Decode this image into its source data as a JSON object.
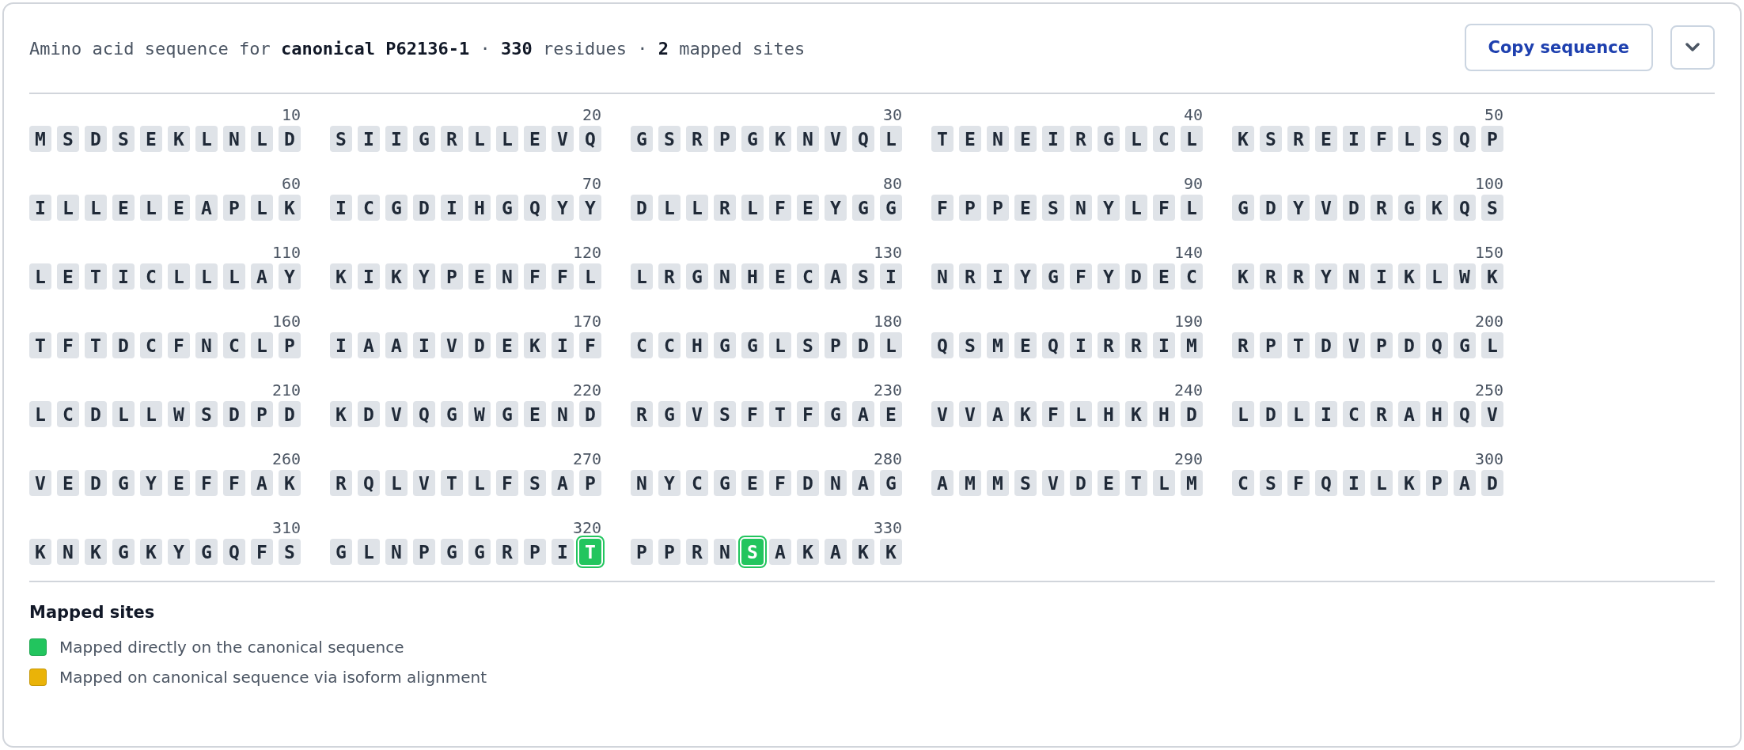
{
  "header": {
    "title": "Amino acid sequence for **canonical P62136-1** · **330** residues · **2** mapped sites",
    "copy_button": "Copy sequence",
    "menu_expanded": false
  },
  "sequence": {
    "blocks": [
      {
        "number": "10",
        "residues": [
          "M",
          "S",
          "D",
          "S",
          "E",
          "K",
          "L",
          "N",
          "L",
          "D"
        ]
      },
      {
        "number": "20",
        "residues": [
          "S",
          "I",
          "I",
          "G",
          "R",
          "L",
          "L",
          "E",
          "V",
          "Q"
        ]
      },
      {
        "number": "30",
        "residues": [
          "G",
          "S",
          "R",
          "P",
          "G",
          "K",
          "N",
          "V",
          "Q",
          "L"
        ]
      },
      {
        "number": "40",
        "residues": [
          "T",
          "E",
          "N",
          "E",
          "I",
          "R",
          "G",
          "L",
          "C",
          "L"
        ]
      },
      {
        "number": "50",
        "residues": [
          "K",
          "S",
          "R",
          "E",
          "I",
          "F",
          "L",
          "S",
          "Q",
          "P"
        ]
      },
      {
        "number": "60",
        "residues": [
          "I",
          "L",
          "L",
          "E",
          "L",
          "E",
          "A",
          "P",
          "L",
          "K"
        ]
      },
      {
        "number": "70",
        "residues": [
          "I",
          "C",
          "G",
          "D",
          "I",
          "H",
          "G",
          "Q",
          "Y",
          "Y"
        ]
      },
      {
        "number": "80",
        "residues": [
          "D",
          "L",
          "L",
          "R",
          "L",
          "F",
          "E",
          "Y",
          "G",
          "G"
        ]
      },
      {
        "number": "90",
        "residues": [
          "F",
          "P",
          "P",
          "E",
          "S",
          "N",
          "Y",
          "L",
          "F",
          "L"
        ]
      },
      {
        "number": "100",
        "residues": [
          "G",
          "D",
          "Y",
          "V",
          "D",
          "R",
          "G",
          "K",
          "Q",
          "S"
        ]
      },
      {
        "number": "110",
        "residues": [
          "L",
          "E",
          "T",
          "I",
          "C",
          "L",
          "L",
          "L",
          "A",
          "Y"
        ]
      },
      {
        "number": "120",
        "residues": [
          "K",
          "I",
          "K",
          "Y",
          "P",
          "E",
          "N",
          "F",
          "F",
          "L"
        ]
      },
      {
        "number": "130",
        "residues": [
          "L",
          "R",
          "G",
          "N",
          "H",
          "E",
          "C",
          "A",
          "S",
          "I"
        ]
      },
      {
        "number": "140",
        "residues": [
          "N",
          "R",
          "I",
          "Y",
          "G",
          "F",
          "Y",
          "D",
          "E",
          "C"
        ]
      },
      {
        "number": "150",
        "residues": [
          "K",
          "R",
          "R",
          "Y",
          "N",
          "I",
          "K",
          "L",
          "W",
          "K"
        ]
      },
      {
        "number": "160",
        "residues": [
          "T",
          "F",
          "T",
          "D",
          "C",
          "F",
          "N",
          "C",
          "L",
          "P"
        ]
      },
      {
        "number": "170",
        "residues": [
          "I",
          "A",
          "A",
          "I",
          "V",
          "D",
          "E",
          "K",
          "I",
          "F"
        ]
      },
      {
        "number": "180",
        "residues": [
          "C",
          "C",
          "H",
          "G",
          "G",
          "L",
          "S",
          "P",
          "D",
          "L"
        ]
      },
      {
        "number": "190",
        "residues": [
          "Q",
          "S",
          "M",
          "E",
          "Q",
          "I",
          "R",
          "R",
          "I",
          "M"
        ]
      },
      {
        "number": "200",
        "residues": [
          "R",
          "P",
          "T",
          "D",
          "V",
          "P",
          "D",
          "Q",
          "G",
          "L"
        ]
      },
      {
        "number": "210",
        "residues": [
          "L",
          "C",
          "D",
          "L",
          "L",
          "W",
          "S",
          "D",
          "P",
          "D"
        ]
      },
      {
        "number": "220",
        "residues": [
          "K",
          "D",
          "V",
          "Q",
          "G",
          "W",
          "G",
          "E",
          "N",
          "D"
        ]
      },
      {
        "number": "230",
        "residues": [
          "R",
          "G",
          "V",
          "S",
          "F",
          "T",
          "F",
          "G",
          "A",
          "E"
        ]
      },
      {
        "number": "240",
        "residues": [
          "V",
          "V",
          "A",
          "K",
          "F",
          "L",
          "H",
          "K",
          "H",
          "D"
        ]
      },
      {
        "number": "250",
        "residues": [
          "L",
          "D",
          "L",
          "I",
          "C",
          "R",
          "A",
          "H",
          "Q",
          "V"
        ]
      },
      {
        "number": "260",
        "residues": [
          "V",
          "E",
          "D",
          "G",
          "Y",
          "E",
          "F",
          "F",
          "A",
          "K"
        ]
      },
      {
        "number": "270",
        "residues": [
          "R",
          "Q",
          "L",
          "V",
          "T",
          "L",
          "F",
          "S",
          "A",
          "P"
        ]
      },
      {
        "number": "280",
        "residues": [
          "N",
          "Y",
          "C",
          "G",
          "E",
          "F",
          "D",
          "N",
          "A",
          "G"
        ]
      },
      {
        "number": "290",
        "residues": [
          "A",
          "M",
          "M",
          "S",
          "V",
          "D",
          "E",
          "T",
          "L",
          "M"
        ]
      },
      {
        "number": "300",
        "residues": [
          "C",
          "S",
          "F",
          "Q",
          "I",
          "L",
          "K",
          "P",
          "A",
          "D"
        ]
      },
      {
        "number": "310",
        "residues": [
          "K",
          "N",
          "K",
          "G",
          "K",
          "Y",
          "G",
          "Q",
          "F",
          "S"
        ]
      },
      {
        "number": "320",
        "residues": [
          "G",
          "L",
          "N",
          "P",
          "G",
          "G",
          "R",
          "P",
          "I",
          {
            "letter": "T",
            "color": "#22c55e"
          }
        ]
      },
      {
        "number": "330",
        "residues": [
          "P",
          "P",
          "R",
          "N",
          {
            "letter": "S",
            "color": "#22c55e"
          },
          "A",
          "K",
          "A",
          "K",
          "K"
        ]
      }
    ]
  },
  "legend": {
    "title": "Mapped sites",
    "items": [
      {
        "color": "#22c55e",
        "label": "Mapped directly on the canonical sequence"
      },
      {
        "color": "#eab308",
        "label": "Mapped on canonical sequence via isoform alignment"
      }
    ]
  }
}
